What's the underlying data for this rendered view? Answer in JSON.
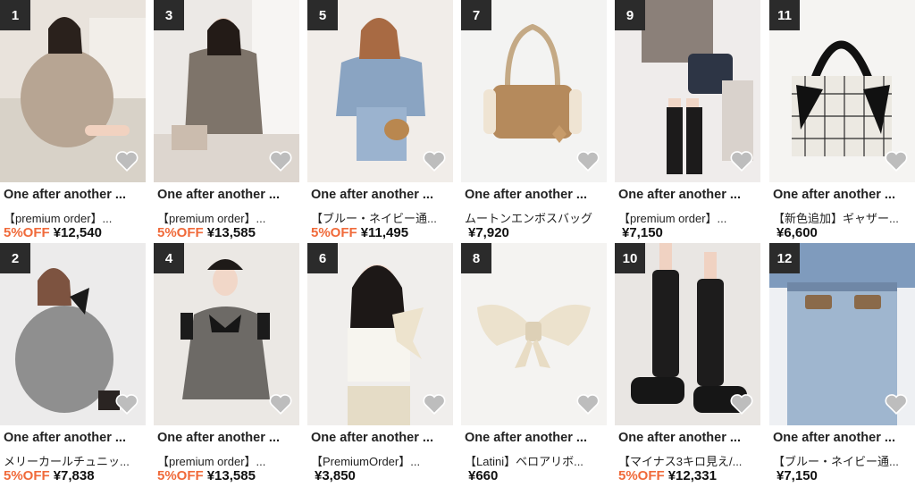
{
  "colors": {
    "accent_off": "#f06a3a",
    "rank_badge": "#2b2b2b"
  },
  "products": [
    {
      "rank": "1",
      "brand": "One after another ...",
      "name": "【premium order】...",
      "off": "5%OFF",
      "price": "¥12,540",
      "icon": "heart-icon"
    },
    {
      "rank": "3",
      "brand": "One after another ...",
      "name": "【premium order】...",
      "off": "5%OFF",
      "price": "¥13,585",
      "icon": "heart-icon"
    },
    {
      "rank": "5",
      "brand": "One after another ...",
      "name": "【ブルー・ネイビー通...",
      "off": "5%OFF",
      "price": "¥11,495",
      "icon": "heart-icon"
    },
    {
      "rank": "7",
      "brand": "One after another ...",
      "name": "ムートンエンボスバッグ",
      "off": "",
      "price": "¥7,920",
      "icon": "heart-icon"
    },
    {
      "rank": "9",
      "brand": "One after another ...",
      "name": "【premium order】...",
      "off": "",
      "price": "¥7,150",
      "icon": "heart-icon"
    },
    {
      "rank": "11",
      "brand": "One after another ...",
      "name": "【新色追加】ギャザー...",
      "off": "",
      "price": "¥6,600",
      "icon": "heart-icon"
    },
    {
      "rank": "2",
      "brand": "One after another ...",
      "name": "メリーカールチュニッ...",
      "off": "5%OFF",
      "price": "¥7,838",
      "icon": "heart-icon"
    },
    {
      "rank": "4",
      "brand": "One after another ...",
      "name": "【premium order】...",
      "off": "5%OFF",
      "price": "¥13,585",
      "icon": "heart-icon"
    },
    {
      "rank": "6",
      "brand": "One after another ...",
      "name": "【PremiumOrder】...",
      "off": "",
      "price": "¥3,850",
      "icon": "heart-icon"
    },
    {
      "rank": "8",
      "brand": "One after another ...",
      "name": "【Latini】ベロアリボ...",
      "off": "",
      "price": "¥660",
      "icon": "heart-icon"
    },
    {
      "rank": "10",
      "brand": "One after another ...",
      "name": "【マイナス3キロ見え/...",
      "off": "5%OFF",
      "price": "¥12,331",
      "icon": "heart-icon"
    },
    {
      "rank": "12",
      "brand": "One after another ...",
      "name": "【ブルー・ネイビー通...",
      "off": "",
      "price": "¥7,150",
      "icon": "heart-icon"
    }
  ]
}
